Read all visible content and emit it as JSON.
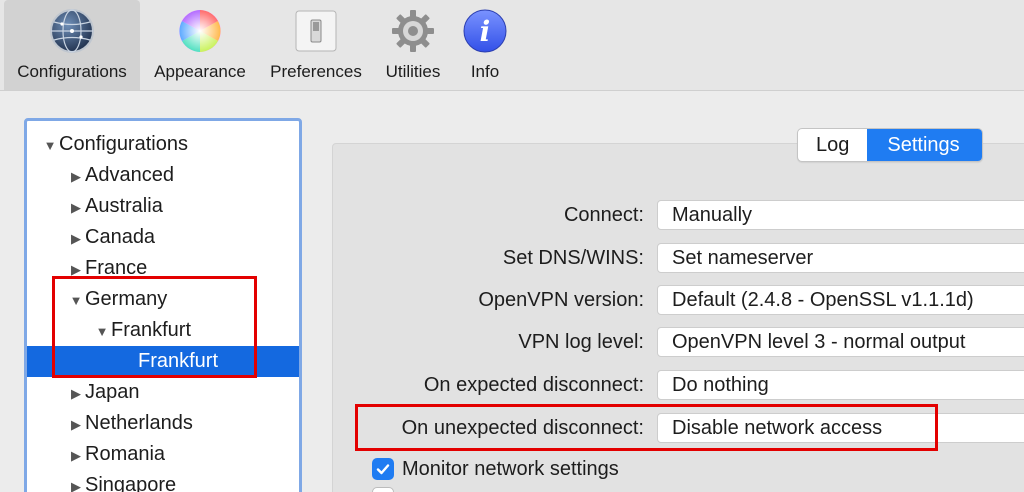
{
  "toolbar": {
    "items": [
      {
        "label": "Configurations",
        "icon": "globe-icon",
        "active": true
      },
      {
        "label": "Appearance",
        "icon": "color-wheel-icon",
        "active": false
      },
      {
        "label": "Preferences",
        "icon": "switch-icon",
        "active": false
      },
      {
        "label": "Utilities",
        "icon": "gear-icon",
        "active": false
      },
      {
        "label": "Info",
        "icon": "info-icon",
        "active": false
      }
    ]
  },
  "sidebar": {
    "items": [
      {
        "label": "Configurations",
        "expanded": true
      },
      {
        "label": "Advanced",
        "expanded": false
      },
      {
        "label": "Australia",
        "expanded": false
      },
      {
        "label": "Canada",
        "expanded": false
      },
      {
        "label": "France",
        "expanded": false
      },
      {
        "label": "Germany",
        "expanded": true
      },
      {
        "label": "Frankfurt",
        "expanded": true
      },
      {
        "label": "Frankfurt",
        "selected": true
      },
      {
        "label": "Japan",
        "expanded": false
      },
      {
        "label": "Netherlands",
        "expanded": false
      },
      {
        "label": "Romania",
        "expanded": false
      },
      {
        "label": "Singapore",
        "expanded": false
      }
    ]
  },
  "tabs": {
    "log": "Log",
    "settings": "Settings",
    "active": "settings"
  },
  "settings": {
    "connect": {
      "label": "Connect:",
      "value": "Manually"
    },
    "dns": {
      "label": "Set DNS/WINS:",
      "value": "Set nameserver"
    },
    "openvpn_version": {
      "label": "OpenVPN version:",
      "value": "Default (2.4.8 - OpenSSL v1.1.1d)"
    },
    "log_level": {
      "label": "VPN log level:",
      "value": "OpenVPN level 3 - normal output"
    },
    "expected_disconnect": {
      "label": "On expected disconnect:",
      "value": "Do nothing"
    },
    "unexpected_disconnect": {
      "label": "On unexpected disconnect:",
      "value": "Disable network access"
    },
    "monitor_network": {
      "label": "Monitor network settings",
      "checked": true
    }
  },
  "colors": {
    "accent": "#1f7cf2",
    "selection": "#1469e0",
    "highlight": "#e30000"
  }
}
